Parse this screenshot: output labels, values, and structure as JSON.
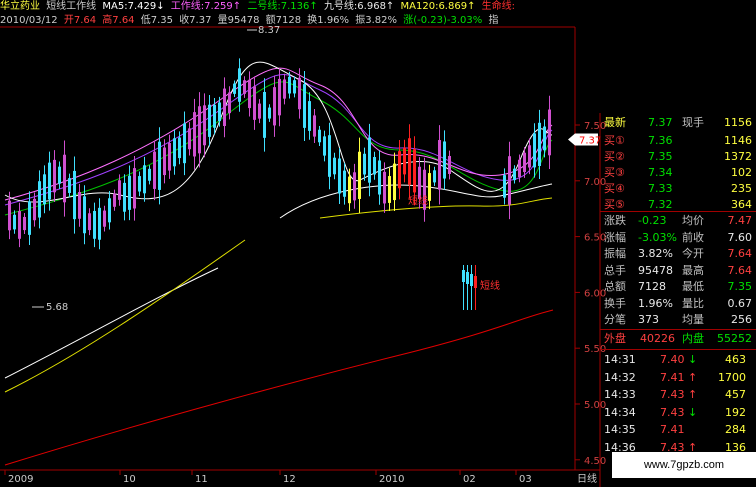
{
  "header": {
    "stock_name": "华立药业",
    "indicator_name": "短线工作线",
    "ma5": "MA5:7.429↓",
    "work_line": "工作线:7.259↑",
    "line2": "二号线:7.136↑",
    "line9": "九号线:6.968↑",
    "ma120": "MA120:6.869↑",
    "life_line": "生命线:"
  },
  "quote_bar": {
    "date": "2010/03/12",
    "open": "开7.64",
    "high": "高7.64",
    "low": "低7.35",
    "close": "收7.37",
    "volume": "量95478",
    "amount": "额7128",
    "turnover": "换1.96%",
    "amplitude": "振3.82%",
    "change": "涨(-0.23)-3.03%",
    "tail": "指"
  },
  "chart_data": {
    "type": "candlestick",
    "price_axis": [
      "7.50",
      "7.00",
      "6.50",
      "6.00",
      "5.50",
      "5.00",
      "4.50"
    ],
    "current_price_tag": "7.37",
    "x_labels": [
      "2009",
      "10",
      "11",
      "12",
      "2010",
      "02",
      "03"
    ],
    "max_label": "8.37",
    "min_label": "5.68",
    "annotations": [
      "短线",
      "短线"
    ],
    "axis_end_label": "日线",
    "colors": {
      "up": "#ff2020",
      "down": "#40e0ff",
      "strong": "#d050d0",
      "yellow_candle": "#ffff40",
      "ma_white": "#ffffff",
      "ma_pink": "#ff70ff",
      "ma_purple": "#a040ff",
      "ma_green": "#00c000",
      "ma_yellow": "#e0e000",
      "ma_red": "#e00000"
    }
  },
  "panel": {
    "latest_label": "最新",
    "latest_value": "7.37",
    "now_hand_label": "现手",
    "now_hand_value": "1156",
    "bids": [
      {
        "label": "买①",
        "price": "7.36",
        "vol": "1146"
      },
      {
        "label": "买②",
        "price": "7.35",
        "vol": "1372"
      },
      {
        "label": "买③",
        "price": "7.34",
        "vol": "102"
      },
      {
        "label": "买④",
        "price": "7.33",
        "vol": "235"
      },
      {
        "label": "买⑤",
        "price": "7.32",
        "vol": "364"
      }
    ],
    "stats": [
      {
        "l1": "涨跌",
        "v1": "-0.23",
        "c1": "green",
        "l2": "均价",
        "v2": "7.47",
        "c2": "red"
      },
      {
        "l1": "涨幅",
        "v1": "-3.03%",
        "c1": "green",
        "l2": "前收",
        "v2": "7.60",
        "c2": "white"
      },
      {
        "l1": "振幅",
        "v1": "3.82%",
        "c1": "white",
        "l2": "今开",
        "v2": "7.64",
        "c2": "red"
      },
      {
        "l1": "总手",
        "v1": "95478",
        "c1": "white",
        "l2": "最高",
        "v2": "7.64",
        "c2": "red"
      },
      {
        "l1": "总额",
        "v1": "7128",
        "c1": "white",
        "l2": "最低",
        "v2": "7.35",
        "c2": "green"
      },
      {
        "l1": "换手",
        "v1": "1.96%",
        "c1": "white",
        "l2": "量比",
        "v2": "0.67",
        "c2": "white"
      },
      {
        "l1": "分笔",
        "v1": "373",
        "c1": "white",
        "l2": "均量",
        "v2": "256",
        "c2": "white"
      }
    ],
    "outer_label": "外盘",
    "outer_value": "40226",
    "inner_label": "内盘",
    "inner_value": "55252",
    "ticks": [
      {
        "time": "14:31",
        "price": "7.40",
        "arrow": "↓",
        "vol": "463",
        "ac": "green"
      },
      {
        "time": "14:32",
        "price": "7.41",
        "arrow": "↑",
        "vol": "1700",
        "ac": "red"
      },
      {
        "time": "14:33",
        "price": "7.43",
        "arrow": "↑",
        "vol": "457",
        "ac": "red"
      },
      {
        "time": "14:34",
        "price": "7.43",
        "arrow": "↓",
        "vol": "192",
        "ac": "green"
      },
      {
        "time": "14:35",
        "price": "7.41",
        "arrow": "",
        "vol": "284",
        "ac": "white"
      },
      {
        "time": "14:36",
        "price": "7.43",
        "arrow": "↑",
        "vol": "136",
        "ac": "red"
      }
    ]
  },
  "watermark": "www.7gpzb.com"
}
